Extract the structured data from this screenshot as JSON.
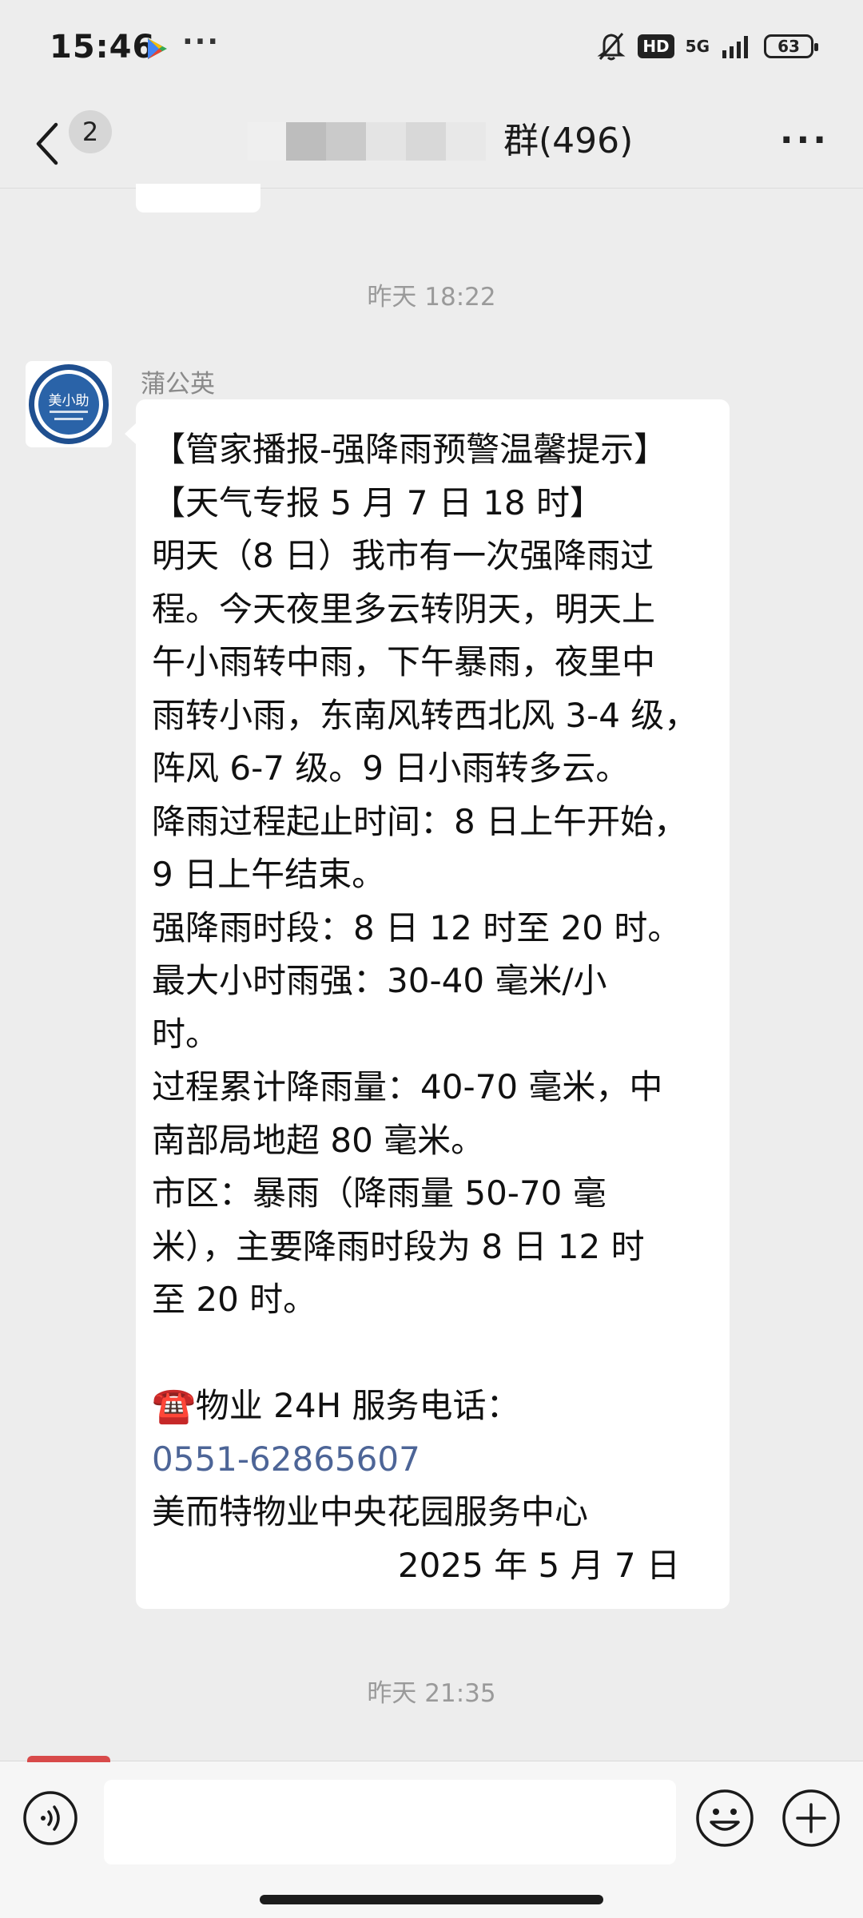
{
  "status_bar": {
    "time": "15:46",
    "network": "5G",
    "hd": "HD",
    "battery": "63"
  },
  "header": {
    "back_badge": "2",
    "title": "群(496)"
  },
  "messages": {
    "timestamp_1": "昨天 18:22",
    "sender": "蒲公英",
    "avatar_text": "美小助",
    "lines": [
      "【管家播报-强降雨预警温馨提示】",
      "【天气专报 5 月 7 日 18 时】",
      "明天（8 日）我市有一次强降雨过",
      "程。今天夜里多云转阴天，明天上",
      "午小雨转中雨，下午暴雨，夜里中",
      "雨转小雨，东南风转西北风 3-4 级，",
      "阵风 6-7 级。9 日小雨转多云。",
      "降雨过程起止时间：8 日上午开始，",
      "9 日上午结束。",
      "强降雨时段：8 日 12 时至 20 时。",
      "最大小时雨强：30-40 毫米/小",
      "时。",
      "过程累计降雨量：40-70 毫米，中",
      "南部局地超 80 毫米。",
      "市区：暴雨（降雨量 50-70 毫",
      "米），主要降雨时段为 8 日 12 时",
      "至 20 时。"
    ],
    "service_label": "物业 24H 服务电话：",
    "phone": "0551-62865607",
    "org": "美而特物业中央花园服务中心",
    "date": "2025 年 5 月 7 日",
    "timestamp_2": "昨天 21:35"
  },
  "colors": {
    "background": "#ededed",
    "bubble": "#ffffff",
    "link": "#4d6597",
    "timestamp": "#9a9a9a"
  }
}
